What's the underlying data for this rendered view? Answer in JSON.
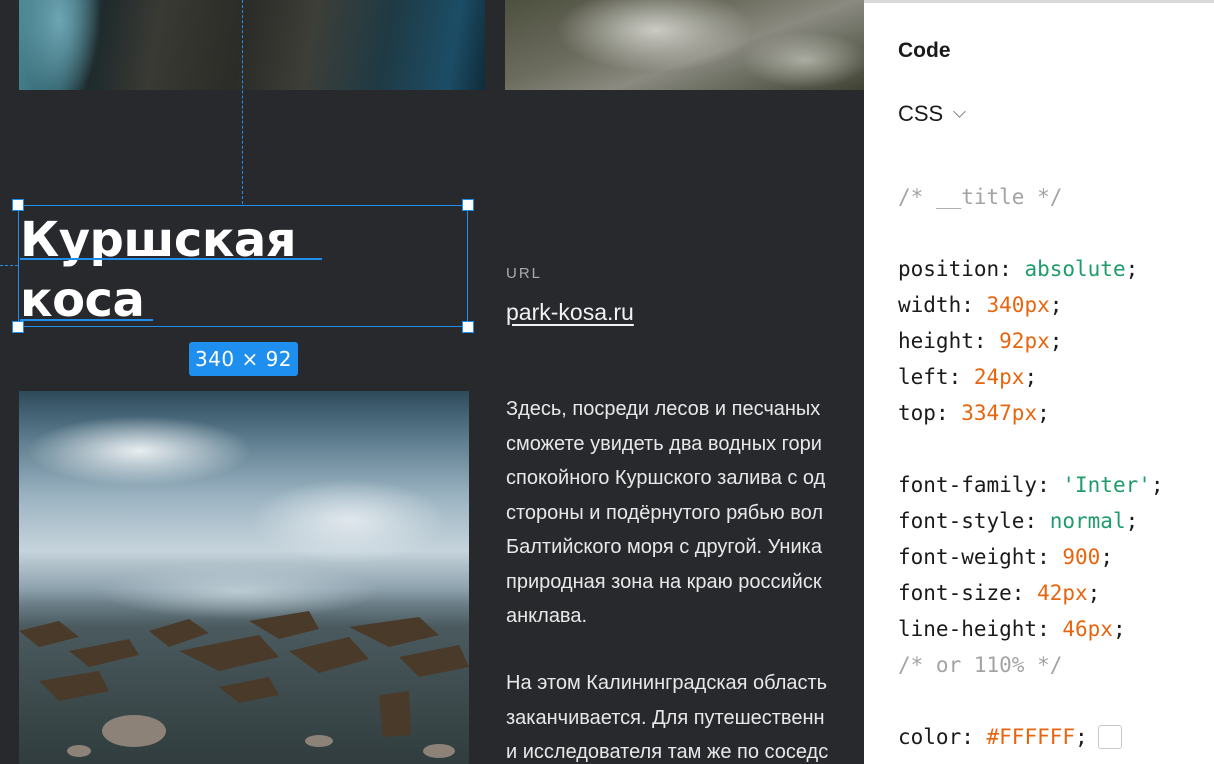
{
  "canvas": {
    "title_lines": [
      "Куршская",
      "коса"
    ],
    "dimension_badge": "340 × 92",
    "url_label": "URL",
    "url_value": "park-kosa.ru",
    "paragraph1": [
      "Здесь, посреди лесов и песчаных",
      "сможете увидеть два водных гори",
      "спокойного Куршского залива с од",
      "стороны и подёрнутого рябью вол",
      "Балтийского моря с другой. Уника",
      "природная зона на краю российск",
      "анклава."
    ],
    "paragraph2": [
      "На этом Калининградская область",
      "заканчивается. Для путешественн",
      "и исследователя там же по соседс"
    ]
  },
  "panel": {
    "title": "Code",
    "language": "CSS",
    "comment_title": "/* __title */",
    "position": {
      "prop": "position",
      "value": "absolute"
    },
    "width": {
      "prop": "width",
      "value": "340px"
    },
    "height": {
      "prop": "height",
      "value": "92px"
    },
    "left": {
      "prop": "left",
      "value": "24px"
    },
    "top": {
      "prop": "top",
      "value": "3347px"
    },
    "font_family": {
      "prop": "font-family",
      "value": "'Inter'"
    },
    "font_style": {
      "prop": "font-style",
      "value": "normal"
    },
    "font_weight": {
      "prop": "font-weight",
      "value": "900"
    },
    "font_size": {
      "prop": "font-size",
      "value": "42px"
    },
    "line_height": {
      "prop": "line-height",
      "value": "46px"
    },
    "comment_lh": "/* or 110% */",
    "color": {
      "prop": "color",
      "value": "#FFFFFF"
    }
  },
  "colors": {
    "selection": "#1e8fef",
    "canvas_bg": "#28292d",
    "code_green": "#1f9c6b",
    "code_orange": "#e8650f"
  }
}
